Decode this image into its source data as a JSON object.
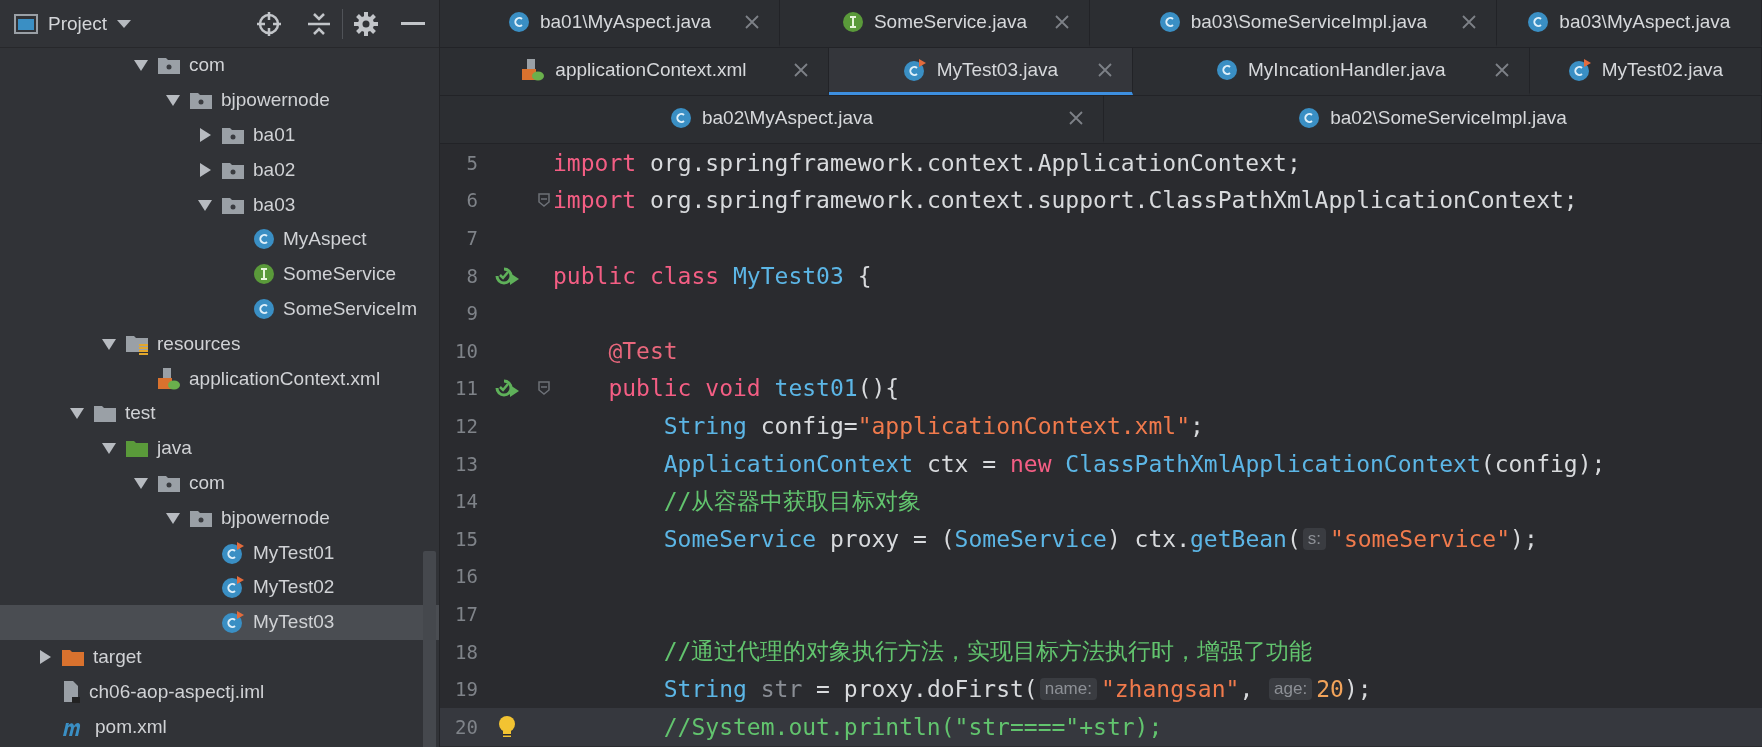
{
  "sidebar": {
    "title": "Project",
    "tree": [
      {
        "children": [
          {
            "children": [
              {
                "children": [
                  {
                    "label": "com",
                    "kind": "package",
                    "expanded": true,
                    "selected": false,
                    "children": [
                      {
                        "label": "bjpowernode",
                        "kind": "package",
                        "expanded": true,
                        "selected": false,
                        "children": [
                          {
                            "label": "ba01",
                            "kind": "package",
                            "expanded": false,
                            "selected": false
                          },
                          {
                            "label": "ba02",
                            "kind": "package",
                            "expanded": false,
                            "selected": false
                          },
                          {
                            "label": "ba03",
                            "kind": "package",
                            "expanded": true,
                            "selected": false,
                            "children": [
                              {
                                "label": "MyAspect",
                                "kind": "class",
                                "selected": false
                              },
                              {
                                "label": "SomeService",
                                "kind": "interface",
                                "selected": false
                              },
                              {
                                "label": "SomeServiceIm",
                                "kind": "class",
                                "selected": false
                              }
                            ]
                          }
                        ]
                      }
                    ]
                  }
                ]
              },
              {
                "label": "resources",
                "kind": "resources",
                "expanded": true,
                "selected": false,
                "children": [
                  {
                    "label": "applicationContext.xml",
                    "kind": "xml",
                    "selected": false
                  }
                ]
              }
            ]
          },
          {
            "label": "test",
            "kind": "folder",
            "expanded": true,
            "selected": false,
            "children": [
              {
                "label": "java",
                "kind": "testroot",
                "expanded": true,
                "selected": false,
                "children": [
                  {
                    "label": "com",
                    "kind": "package",
                    "expanded": true,
                    "selected": false,
                    "children": [
                      {
                        "label": "bjpowernode",
                        "kind": "package",
                        "expanded": true,
                        "selected": false,
                        "children": [
                          {
                            "label": "MyTest01",
                            "kind": "test",
                            "selected": false
                          },
                          {
                            "label": "MyTest02",
                            "kind": "test",
                            "selected": false
                          },
                          {
                            "label": "MyTest03",
                            "kind": "test",
                            "selected": true
                          }
                        ]
                      }
                    ]
                  }
                ]
              }
            ]
          }
        ]
      },
      {
        "label": "target",
        "kind": "excluded",
        "expanded": false,
        "selected": false
      },
      {
        "label": "ch06-aop-aspectj.iml",
        "kind": "iml",
        "selected": false
      },
      {
        "label": "pom.xml",
        "kind": "maven",
        "selected": false
      }
    ]
  },
  "tab_rows": [
    [
      {
        "label": "ba01\\MyAspect.java",
        "kind": "class",
        "selected": false,
        "closable": true
      },
      {
        "label": "SomeService.java",
        "kind": "interface",
        "selected": false,
        "closable": true
      },
      {
        "label": "ba03\\SomeServiceImpl.java",
        "kind": "class",
        "selected": false,
        "closable": true
      },
      {
        "label": "ba03\\MyAspect.java",
        "kind": "class",
        "selected": false,
        "closable": false
      }
    ],
    [
      {
        "label": "applicationContext.xml",
        "kind": "xml",
        "selected": false,
        "closable": true
      },
      {
        "label": "MyTest03.java",
        "kind": "test",
        "selected": true,
        "closable": true
      },
      {
        "label": "MyIncationHandler.java",
        "kind": "class",
        "selected": false,
        "closable": true
      },
      {
        "label": "MyTest02.java",
        "kind": "test",
        "selected": false,
        "closable": false
      }
    ],
    [
      {
        "label": "ba02\\MyAspect.java",
        "kind": "class",
        "selected": false,
        "closable": true
      },
      {
        "label": "ba02\\SomeServiceImpl.java",
        "kind": "class",
        "selected": false,
        "closable": false
      }
    ]
  ],
  "editor": {
    "lines": [
      {
        "number": "5",
        "kind": "plain",
        "current": false,
        "tokens": [
          {
            "kind": "keyword",
            "text": "import"
          },
          {
            "kind": "plain",
            "text": " org.springframework.context.ApplicationContext;"
          }
        ]
      },
      {
        "number": "6",
        "kind": "plain",
        "current": false,
        "fold": true,
        "tokens": [
          {
            "kind": "keyword",
            "text": "import"
          },
          {
            "kind": "plain",
            "text": " org.springframework.context.support.ClassPathXmlApplicationContext;"
          }
        ]
      },
      {
        "number": "7",
        "kind": "plain",
        "current": false
      },
      {
        "number": "8",
        "kind": "run",
        "current": false,
        "tokens": [
          {
            "kind": "keyword",
            "text": "public class "
          },
          {
            "kind": "type",
            "text": "MyTest03"
          },
          {
            "kind": "plain",
            "text": " {"
          }
        ]
      },
      {
        "number": "9",
        "kind": "plain",
        "current": false
      },
      {
        "number": "10",
        "kind": "plain",
        "current": false,
        "tokens": [
          {
            "kind": "annotation",
            "text": "    @Test"
          }
        ]
      },
      {
        "number": "11",
        "kind": "run",
        "current": false,
        "fold": true,
        "tokens": [
          {
            "kind": "keyword",
            "text": "    public void "
          },
          {
            "kind": "type",
            "text": "test01"
          },
          {
            "kind": "plain",
            "text": "(){"
          }
        ]
      },
      {
        "number": "12",
        "kind": "plain",
        "current": false,
        "tokens": [
          {
            "kind": "type",
            "text": "        String"
          },
          {
            "kind": "plain",
            "text": " config="
          },
          {
            "kind": "string",
            "text": "\"applicationContext.xml\""
          },
          {
            "kind": "plain",
            "text": ";"
          }
        ]
      },
      {
        "number": "13",
        "kind": "plain",
        "current": false,
        "tokens": [
          {
            "kind": "type",
            "text": "        ApplicationContext"
          },
          {
            "kind": "plain",
            "text": " ctx = "
          },
          {
            "kind": "keyword",
            "text": "new"
          },
          {
            "kind": "type",
            "text": " ClassPathXmlApplicationContext"
          },
          {
            "kind": "plain",
            "text": "(config);"
          }
        ]
      },
      {
        "number": "14",
        "kind": "plain",
        "current": false,
        "tokens": [
          {
            "kind": "comment",
            "text": "        //从容器中获取目标对象"
          }
        ]
      },
      {
        "number": "15",
        "kind": "plain",
        "current": false,
        "tokens": [
          {
            "kind": "type",
            "text": "        SomeService"
          },
          {
            "kind": "plain",
            "text": " proxy = ("
          },
          {
            "kind": "type",
            "text": "SomeService"
          },
          {
            "kind": "plain",
            "text": ") ctx."
          },
          {
            "kind": "type",
            "text": "getBean"
          },
          {
            "kind": "plain",
            "text": "("
          },
          {
            "kind": "hint",
            "text": "s:"
          },
          {
            "kind": "string",
            "text": "\"someService\""
          },
          {
            "kind": "plain",
            "text": ");"
          }
        ]
      },
      {
        "number": "16",
        "kind": "plain",
        "current": false
      },
      {
        "number": "17",
        "kind": "plain",
        "current": false
      },
      {
        "number": "18",
        "kind": "plain",
        "current": false,
        "tokens": [
          {
            "kind": "comment",
            "text": "        //通过代理的对象执行方法，实现目标方法执行时，增强了功能"
          }
        ]
      },
      {
        "number": "19",
        "kind": "plain",
        "current": false,
        "tokens": [
          {
            "kind": "type",
            "text": "        String"
          },
          {
            "kind": "unused",
            "text": " str"
          },
          {
            "kind": "plain",
            "text": " = proxy.doFirst("
          },
          {
            "kind": "hint",
            "text": "name:"
          },
          {
            "kind": "string",
            "text": "\"zhangsan\""
          },
          {
            "kind": "plain",
            "text": ", "
          },
          {
            "kind": "hint",
            "text": "age:"
          },
          {
            "kind": "number",
            "text": "20"
          },
          {
            "kind": "plain",
            "text": ");"
          }
        ]
      },
      {
        "number": "20",
        "kind": "bulb",
        "current": true,
        "tokens": [
          {
            "kind": "comment",
            "text": "        //System.out.println(\"str====\"+str);"
          }
        ]
      }
    ]
  }
}
